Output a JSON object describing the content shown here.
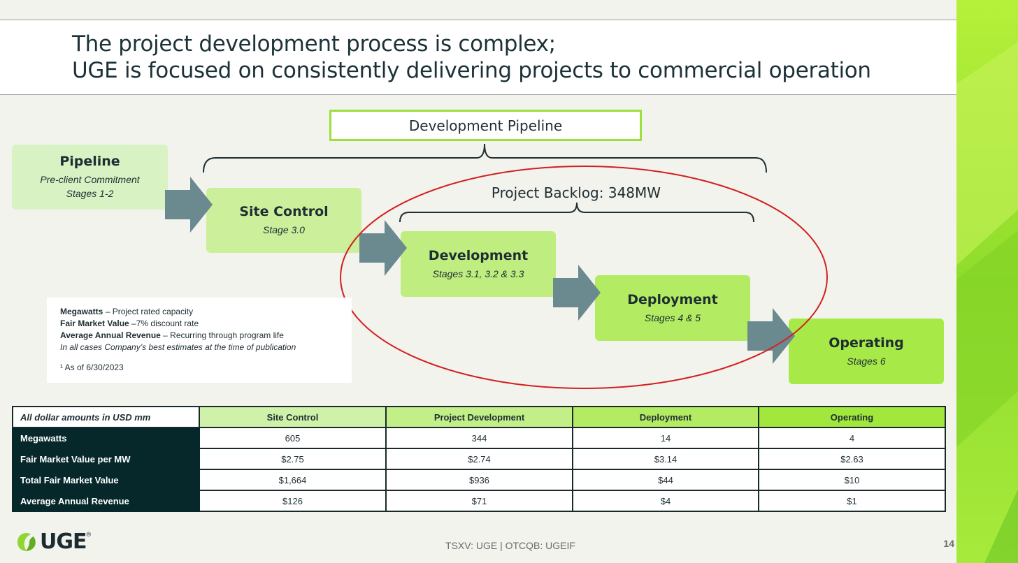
{
  "title": {
    "line1": "The project development process is complex;",
    "line2": "UGE is focused on consistently delivering projects to commercial operation"
  },
  "pipeline_header": "Development Pipeline",
  "backlog_label": "Project Backlog: 348MW",
  "stages": [
    {
      "name": "Pipeline",
      "sub1": "Pre-client Commitment",
      "sub2": "Stages 1-2"
    },
    {
      "name": "Site Control",
      "sub1": "Stage 3.0"
    },
    {
      "name": "Development",
      "sub1": "Stages 3.1, 3.2 & 3.3"
    },
    {
      "name": "Deployment",
      "sub1": "Stages 4 & 5"
    },
    {
      "name": "Operating",
      "sub1": "Stages 6"
    }
  ],
  "legend": {
    "mw_term": "Megawatts",
    "mw_desc": " – Project rated capacity",
    "fmv_term": "Fair Market Value",
    "fmv_desc": " –7% discount rate",
    "aar_term": "Average Annual Revenue",
    "aar_desc": " – Recurring through program life",
    "note": "In all cases Company’s best estimates at the time of publication",
    "footnote": "¹ As of 6/30/2023"
  },
  "table": {
    "corner": "All dollar amounts in USD mm",
    "columns": [
      "Site Control",
      "Project Development",
      "Deployment",
      "Operating"
    ],
    "rows": [
      {
        "label": "Megawatts",
        "values": [
          "605",
          "344",
          "14",
          "4"
        ]
      },
      {
        "label": "Fair Market Value per MW",
        "values": [
          "$2.75",
          "$2.74",
          "$3.14",
          "$2.63"
        ]
      },
      {
        "label": "Total Fair Market Value",
        "values": [
          "$1,664",
          "$936",
          "$44",
          "$10"
        ]
      },
      {
        "label": "Average Annual Revenue",
        "values": [
          "$126",
          "$71",
          "$4",
          "$1"
        ]
      }
    ]
  },
  "logo": {
    "text": "UGE",
    "reg": "®"
  },
  "footer": {
    "ticker": "TSXV: UGE | OTCQB: UGEIF",
    "page": "14"
  },
  "colors": {
    "accent_green": "#9be03c",
    "arrow_gray": "#6b8a8f",
    "oval_red": "#d21f1f",
    "row_header_dark": "#06282b"
  }
}
